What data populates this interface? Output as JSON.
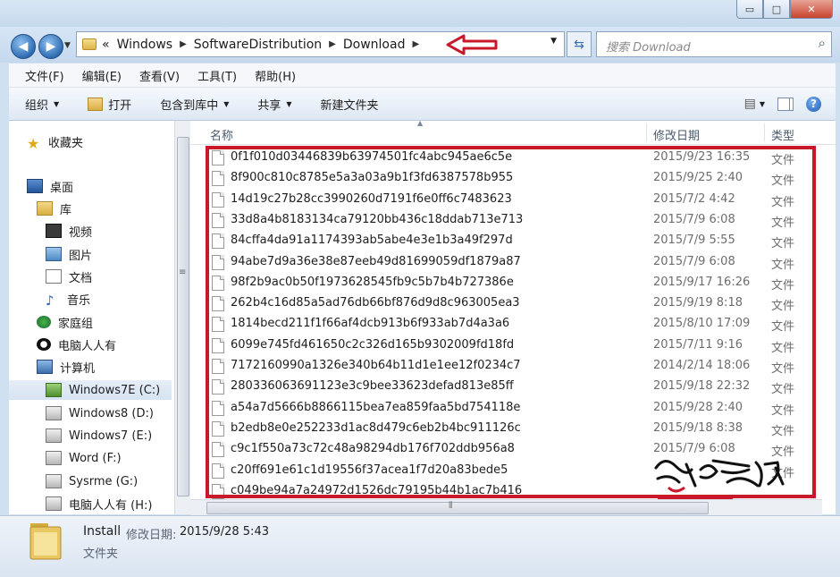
{
  "window": {
    "buttons": {
      "minimize": "▭",
      "maximize": "□",
      "close": "✕"
    }
  },
  "nav": {
    "back_icon": "back-arrow-icon",
    "forward_icon": "forward-arrow-icon",
    "breadcrumb_prefix": "«",
    "breadcrumb": [
      "Windows",
      "SoftwareDistribution",
      "Download"
    ],
    "search_placeholder": "搜索 Download"
  },
  "menu": [
    "文件(F)",
    "编辑(E)",
    "查看(V)",
    "工具(T)",
    "帮助(H)"
  ],
  "commands": {
    "organize": "组织",
    "open": "打开",
    "include_in_library": "包含到库中",
    "share": "共享",
    "new_folder": "新建文件夹"
  },
  "sidebar": {
    "favorites": "收藏夹",
    "desktop": "桌面",
    "libraries": "库",
    "videos": "视频",
    "pictures": "图片",
    "documents": "文档",
    "music": "音乐",
    "homegroup": "家庭组",
    "user": "电脑人人有",
    "computer": "计算机",
    "drives": [
      "Windows7E (C:)",
      "Windows8 (D:)",
      "Windows7 (E:)",
      "Word (F:)",
      "Sysrme (G:)",
      "电脑人人有 (H:)"
    ]
  },
  "columns": {
    "name": "名称",
    "date": "修改日期",
    "type": "类型"
  },
  "files": [
    {
      "name": "0f1f010d03446839b63974501fc4abc945ae6c5e",
      "date": "2015/9/23 16:35",
      "type": "文件"
    },
    {
      "name": "8f900c810c8785e5a3a03a9b1f3fd6387578b955",
      "date": "2015/9/25 2:40",
      "type": "文件"
    },
    {
      "name": "14d19c27b28cc3990260d7191f6e0ff6c7483623",
      "date": "2015/7/2 4:42",
      "type": "文件"
    },
    {
      "name": "33d8a4b8183134ca79120bb436c18ddab713e713",
      "date": "2015/7/9 6:08",
      "type": "文件"
    },
    {
      "name": "84cffa4da91a1174393ab5abe4e3e1b3a49f297d",
      "date": "2015/7/9 5:55",
      "type": "文件"
    },
    {
      "name": "94abe7d9a36e38e87eeb49d81699059df1879a87",
      "date": "2015/7/9 6:08",
      "type": "文件"
    },
    {
      "name": "98f2b9ac0b50f1973628545fb9c5b7b4b727386e",
      "date": "2015/9/17 16:26",
      "type": "文件"
    },
    {
      "name": "262b4c16d85a5ad76db66bf876d9d8c963005ea3",
      "date": "2015/9/19 8:18",
      "type": "文件"
    },
    {
      "name": "1814becd211f1f66af4dcb913b6f933ab7d4a3a6",
      "date": "2015/8/10 17:09",
      "type": "文件"
    },
    {
      "name": "6099e745fd461650c2c326d165b9302009fd18fd",
      "date": "2015/7/11 9:16",
      "type": "文件"
    },
    {
      "name": "7172160990a1326e340b64b11d1e1ee12f0234c7",
      "date": "2014/2/14 18:06",
      "type": "文件"
    },
    {
      "name": "280336063691123e3c9bee33623defad813e85ff",
      "date": "2015/9/18 22:32",
      "type": "文件"
    },
    {
      "name": "a54a7d5666b8866115bea7ea859faa5bd754118e",
      "date": "2015/9/28 2:40",
      "type": "文件"
    },
    {
      "name": "b2edb8e0e252233d1ac8d479c6eb2b4bc911126c",
      "date": "2015/9/18 8:38",
      "type": "文件"
    },
    {
      "name": "c9c1f550a73c72c48a98294db176f702ddb956a8",
      "date": "2015/7/9 6:08",
      "type": "文件"
    },
    {
      "name": "c20ff691e61c1d19556f37acea1f7d20a83bede5",
      "date": "",
      "type": "文件"
    },
    {
      "name": "c049be94a7a24972d1526dc79195b44b1ac7b416",
      "date": "",
      "type": ""
    }
  ],
  "details": {
    "name": "Install",
    "modified_label": "修改日期:",
    "modified_value": "2015/9/28 5:43",
    "type": "文件夹"
  },
  "colors": {
    "annotation": "#c8182a",
    "accent": "#2f6db3"
  }
}
